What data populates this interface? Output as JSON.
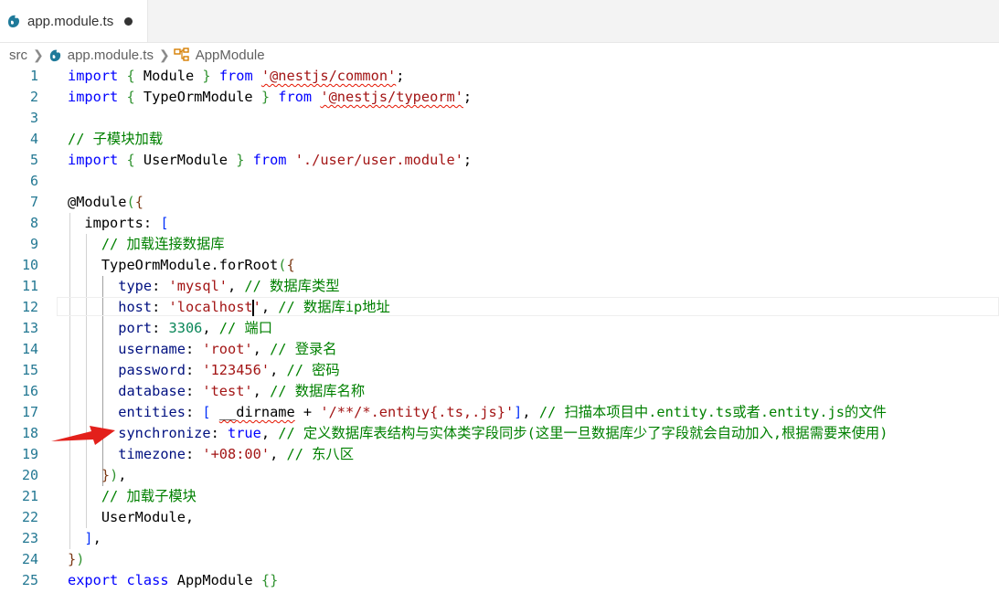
{
  "tab": {
    "label": "app.module.ts",
    "icon": "nestjs-icon",
    "modified": true
  },
  "breadcrumb": {
    "folder": "src",
    "file": "app.module.ts",
    "symbol": "AppModule"
  },
  "colors": {
    "keyword": "#0000ff",
    "string": "#a31515",
    "comment": "#008000",
    "number": "#098658",
    "variable": "#001080",
    "class": "#267f99",
    "decorator": "#795e26",
    "line_number": "#237893",
    "error_squiggle": "#e51400",
    "arrow": "#e3201b",
    "nest_icon": "#1f7a9a"
  },
  "lines": [
    {
      "num": "1",
      "tokens": [
        [
          "import",
          "kw"
        ],
        [
          " "
        ],
        [
          "{",
          "b1"
        ],
        [
          " Module "
        ],
        [
          "}",
          "b1"
        ],
        [
          " "
        ],
        [
          "from",
          "kw"
        ],
        [
          " "
        ],
        [
          "'@nestjs/common'",
          "str squig"
        ],
        [
          ";"
        ]
      ]
    },
    {
      "num": "2",
      "tokens": [
        [
          "import",
          "kw"
        ],
        [
          " "
        ],
        [
          "{",
          "b1"
        ],
        [
          " TypeOrmModule "
        ],
        [
          "}",
          "b1"
        ],
        [
          " "
        ],
        [
          "from",
          "kw"
        ],
        [
          " "
        ],
        [
          "'@nestjs/typeorm'",
          "str squig"
        ],
        [
          ";"
        ]
      ]
    },
    {
      "num": "3",
      "tokens": []
    },
    {
      "num": "4",
      "tokens": [
        [
          "// 子模块加载",
          "cm"
        ]
      ]
    },
    {
      "num": "5",
      "tokens": [
        [
          "import",
          "kw"
        ],
        [
          " "
        ],
        [
          "{",
          "b1"
        ],
        [
          " UserModule "
        ],
        [
          "}",
          "b1"
        ],
        [
          " "
        ],
        [
          "from",
          "kw"
        ],
        [
          " "
        ],
        [
          "'./user/user.module'",
          "str"
        ],
        [
          ";"
        ]
      ]
    },
    {
      "num": "6",
      "tokens": []
    },
    {
      "num": "7",
      "tokens": [
        [
          "@Module"
        ],
        [
          "(",
          "b1"
        ],
        [
          "{",
          "b2"
        ]
      ]
    },
    {
      "num": "8",
      "tokens": [
        [
          "  imports"
        ],
        [
          ": "
        ],
        [
          "[",
          "b3"
        ]
      ]
    },
    {
      "num": "9",
      "tokens": [
        [
          "    "
        ],
        [
          "// 加载连接数据库",
          "cm"
        ]
      ]
    },
    {
      "num": "10",
      "tokens": [
        [
          "    TypeOrmModule.forRoot"
        ],
        [
          "(",
          "b1"
        ],
        [
          "{",
          "b2"
        ]
      ]
    },
    {
      "num": "11",
      "tokens": [
        [
          "      "
        ],
        [
          "type",
          "var"
        ],
        [
          ": "
        ],
        [
          "'mysql'",
          "str"
        ],
        [
          ", "
        ],
        [
          "// 数据库类型",
          "cm"
        ]
      ]
    },
    {
      "num": "12",
      "tokens": [
        [
          "      "
        ],
        [
          "host",
          "var"
        ],
        [
          ": "
        ],
        [
          "'localhost",
          "str"
        ],
        [
          "",
          "cursor"
        ],
        [
          "'",
          "str"
        ],
        [
          ", "
        ],
        [
          "// 数据库ip地址",
          "cm"
        ]
      ],
      "current": true
    },
    {
      "num": "13",
      "tokens": [
        [
          "      "
        ],
        [
          "port",
          "var"
        ],
        [
          ": "
        ],
        [
          "3306",
          "num"
        ],
        [
          ", "
        ],
        [
          "// 端口",
          "cm"
        ]
      ]
    },
    {
      "num": "14",
      "tokens": [
        [
          "      "
        ],
        [
          "username",
          "var"
        ],
        [
          ": "
        ],
        [
          "'root'",
          "str"
        ],
        [
          ", "
        ],
        [
          "// 登录名",
          "cm"
        ]
      ]
    },
    {
      "num": "15",
      "tokens": [
        [
          "      "
        ],
        [
          "password",
          "var"
        ],
        [
          ": "
        ],
        [
          "'123456'",
          "str"
        ],
        [
          ", "
        ],
        [
          "// 密码",
          "cm"
        ]
      ]
    },
    {
      "num": "16",
      "tokens": [
        [
          "      "
        ],
        [
          "database",
          "var"
        ],
        [
          ": "
        ],
        [
          "'test'",
          "str"
        ],
        [
          ", "
        ],
        [
          "// 数据库名称",
          "cm"
        ]
      ]
    },
    {
      "num": "17",
      "tokens": [
        [
          "      "
        ],
        [
          "entities",
          "var"
        ],
        [
          ": "
        ],
        [
          "[",
          "b3"
        ],
        [
          " "
        ],
        [
          "__dirname",
          "squig"
        ],
        [
          " + "
        ],
        [
          "'/**/*.entity{.ts,.js}'",
          "str"
        ],
        [
          "]",
          "b3"
        ],
        [
          ", "
        ],
        [
          "// 扫描本项目中.entity.ts或者.entity.js的文件",
          "cm"
        ]
      ]
    },
    {
      "num": "18",
      "tokens": [
        [
          "      "
        ],
        [
          "synchronize",
          "var"
        ],
        [
          ": "
        ],
        [
          "true",
          "kw"
        ],
        [
          ", "
        ],
        [
          "// 定义数据库表结构与实体类字段同步(这里一旦数据库少了字段就会自动加入,根据需要来使用)",
          "cm"
        ]
      ]
    },
    {
      "num": "19",
      "tokens": [
        [
          "      "
        ],
        [
          "timezone",
          "var"
        ],
        [
          ": "
        ],
        [
          "'+08:00'",
          "str"
        ],
        [
          ", "
        ],
        [
          "// 东八区",
          "cm"
        ]
      ]
    },
    {
      "num": "20",
      "tokens": [
        [
          "    "
        ],
        [
          "}",
          "b2"
        ],
        [
          ")",
          "b1"
        ],
        [
          ","
        ]
      ]
    },
    {
      "num": "21",
      "tokens": [
        [
          "    "
        ],
        [
          "// 加载子模块",
          "cm"
        ]
      ]
    },
    {
      "num": "22",
      "tokens": [
        [
          "    UserModule,"
        ]
      ]
    },
    {
      "num": "23",
      "tokens": [
        [
          "  "
        ],
        [
          "]",
          "b3"
        ],
        [
          ","
        ]
      ]
    },
    {
      "num": "24",
      "tokens": [
        [
          "}",
          "b2"
        ],
        [
          ")",
          "b1"
        ]
      ]
    },
    {
      "num": "25",
      "tokens": [
        [
          "export",
          "kw"
        ],
        [
          " "
        ],
        [
          "class",
          "kw"
        ],
        [
          " AppModule "
        ],
        [
          "{}",
          "b1"
        ]
      ]
    }
  ]
}
